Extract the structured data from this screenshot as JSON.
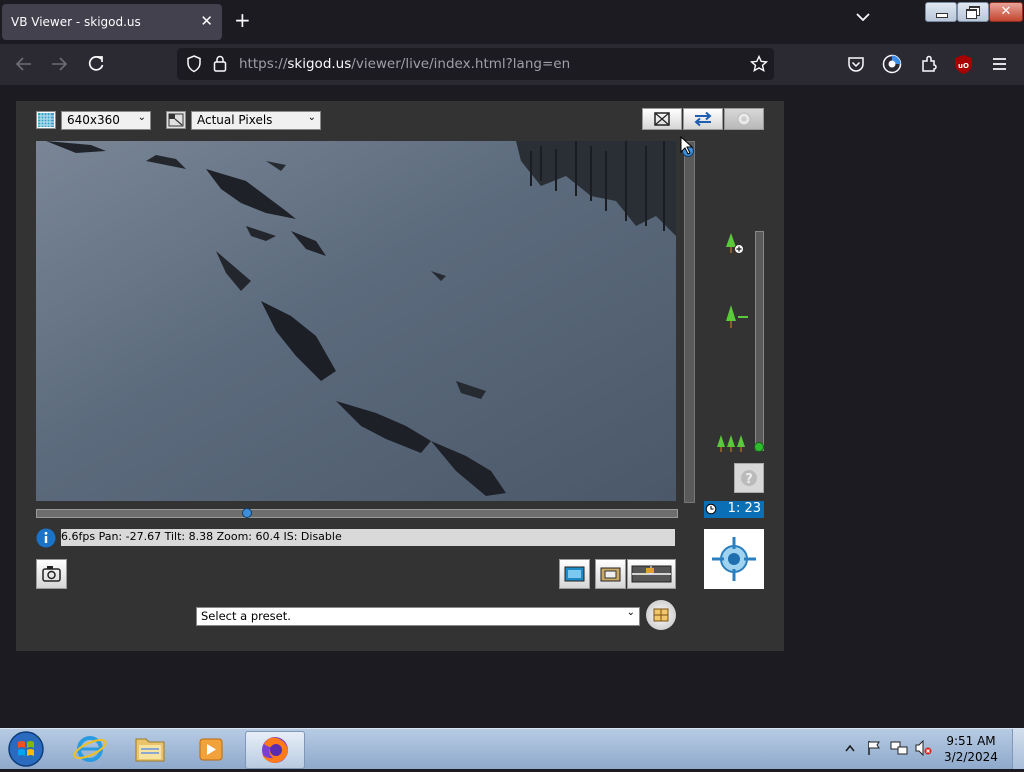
{
  "browser": {
    "tab_title": "VB Viewer - skigod.us",
    "tab_close": "✕",
    "new_tab": "+",
    "url_prefix": "https://",
    "url_host": "skigod.us",
    "url_path": "/viewer/live/index.html?lang=en"
  },
  "viewer": {
    "resolution": "640x360",
    "scale": "Actual Pixels",
    "status_text": "6.6fps Pan: -27.67 Tilt: 8.38 Zoom: 60.4 IS: Disable",
    "timer": "1: 23",
    "preset_placeholder": "Select a preset.",
    "pan_fraction": 0.33,
    "zoom_fraction": 0.0
  },
  "taskbar": {
    "time": "9:51 AM",
    "date": "3/2/2024"
  },
  "colors": {
    "browser_bg": "#1c1b22",
    "viewer_bg": "#333333",
    "timer_bg": "#0a6fb4"
  }
}
